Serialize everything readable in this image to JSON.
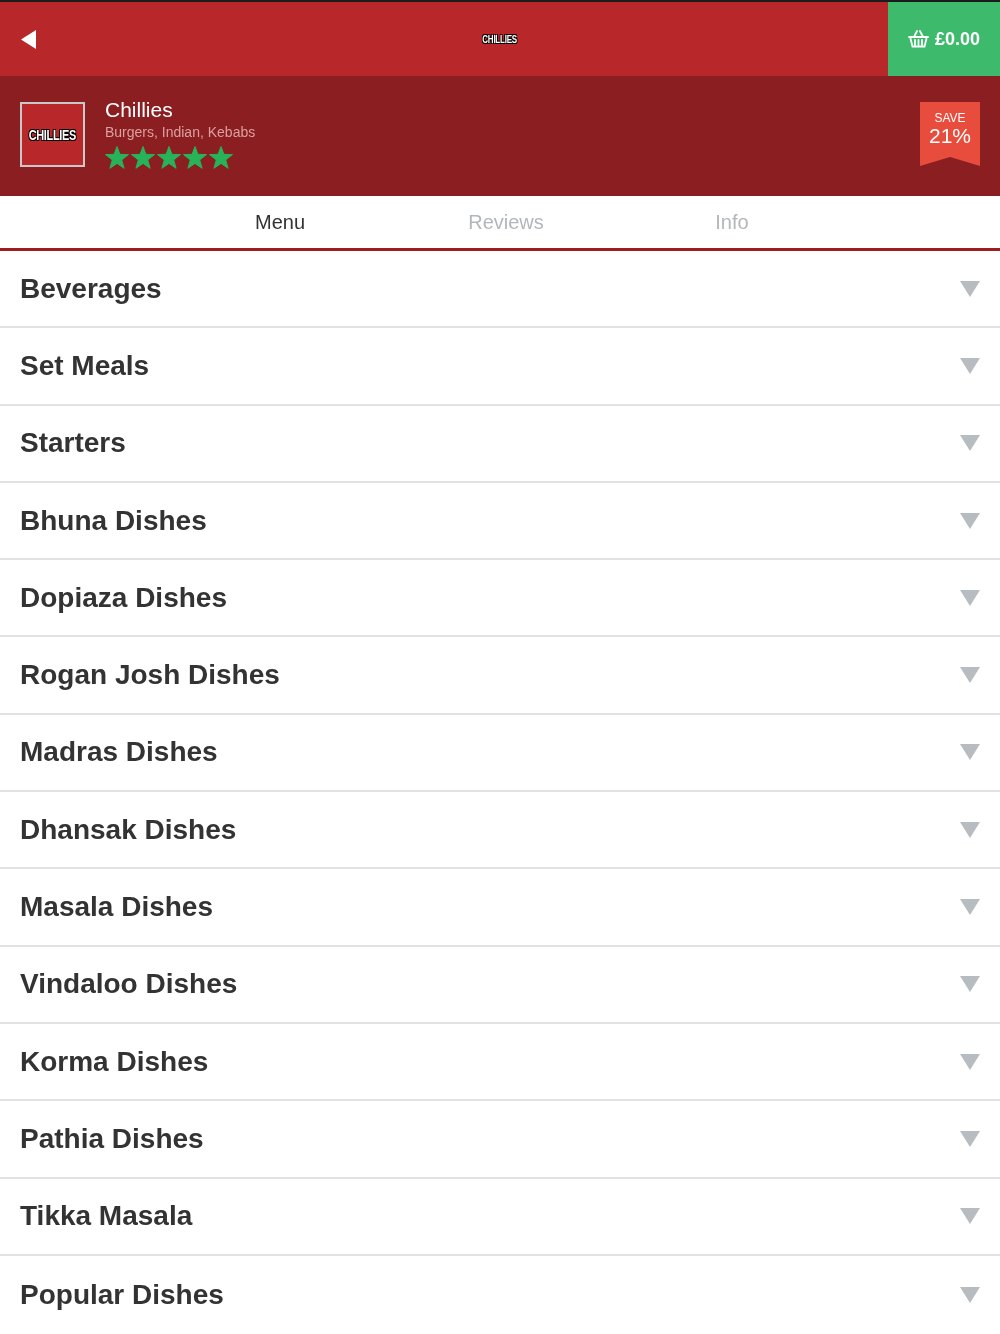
{
  "top_bar": {
    "title": "CHILLIES",
    "basket_total": "£0.00"
  },
  "restaurant": {
    "logo_text": "CHILLIES",
    "name": "Chillies",
    "cuisines": "Burgers, Indian, Kebabs",
    "stars": 5,
    "badge": {
      "label": "SAVE",
      "value": "21%"
    }
  },
  "tabs": [
    {
      "label": "Menu",
      "selected": true
    },
    {
      "label": "Reviews",
      "selected": false
    },
    {
      "label": "Info",
      "selected": false
    }
  ],
  "categories": [
    "Beverages",
    "Set Meals",
    "Starters",
    "Bhuna Dishes",
    "Dopiaza Dishes",
    "Rogan Josh Dishes",
    "Madras Dishes",
    "Dhansak Dishes",
    "Masala Dishes",
    "Vindaloo Dishes",
    "Korma Dishes",
    "Pathia Dishes",
    "Tikka Masala",
    "Popular Dishes"
  ]
}
